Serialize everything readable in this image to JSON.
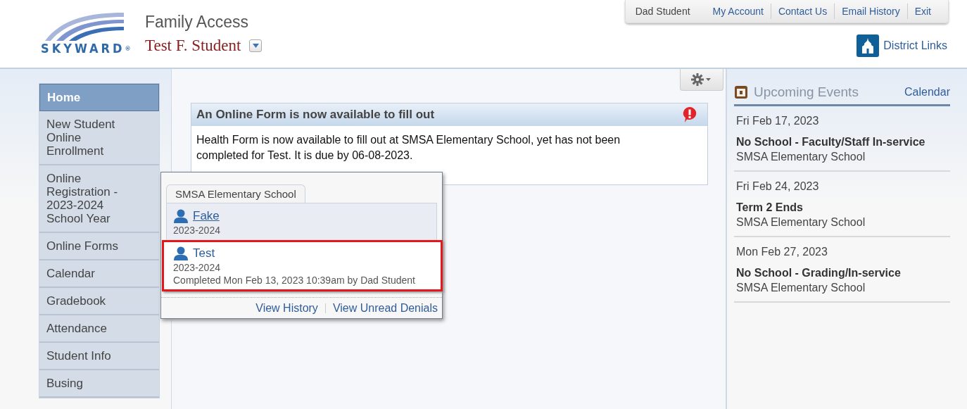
{
  "header": {
    "logo_text": "SKYWARD",
    "logo_mark": "®",
    "app_title": "Family Access",
    "student_name": "Test F. Student"
  },
  "top_nav": {
    "user": "Dad Student",
    "links": [
      "My Account",
      "Contact Us",
      "Email History",
      "Exit"
    ]
  },
  "district_links": "District Links",
  "sidebar": {
    "items": [
      {
        "label": "Home",
        "selected": true
      },
      {
        "label": "New Student Online Enrollment",
        "selected": false
      },
      {
        "label": "Online Registration - 2023-2024 School Year",
        "selected": false
      },
      {
        "label": "Online Forms",
        "selected": false
      },
      {
        "label": "Calendar",
        "selected": false
      },
      {
        "label": "Gradebook",
        "selected": false
      },
      {
        "label": "Attendance",
        "selected": false
      },
      {
        "label": "Student Info",
        "selected": false
      },
      {
        "label": "Busing",
        "selected": false
      }
    ]
  },
  "message": {
    "title": "An Online Form is now available to fill out",
    "body": "Health Form is now available to fill out at SMSA Elementary School, yet has not been completed for Test.  It is due by 06-08-2023."
  },
  "popup": {
    "tab": "SMSA Elementary School",
    "entries": [
      {
        "name": "Fake",
        "year": "2023-2024",
        "highlighted": false,
        "underlined": true
      },
      {
        "name": "Test",
        "year": "2023-2024",
        "status": "Completed Mon Feb 13, 2023 10:39am by Dad Student",
        "highlighted": true,
        "underlined": false
      }
    ],
    "links": [
      "View History",
      "View Unread Denials"
    ]
  },
  "events": {
    "title": "Upcoming Events",
    "link": "Calendar",
    "items": [
      {
        "date": "Fri Feb 17, 2023",
        "name": "No School - Faculty/Staff In-service",
        "school": "SMSA Elementary School"
      },
      {
        "date": "Fri Feb 24, 2023",
        "name": "Term 2 Ends",
        "school": "SMSA Elementary School"
      },
      {
        "date": "Mon Feb 27, 2023",
        "name": "No School - Grading/In-service",
        "school": "SMSA Elementary School"
      }
    ]
  }
}
